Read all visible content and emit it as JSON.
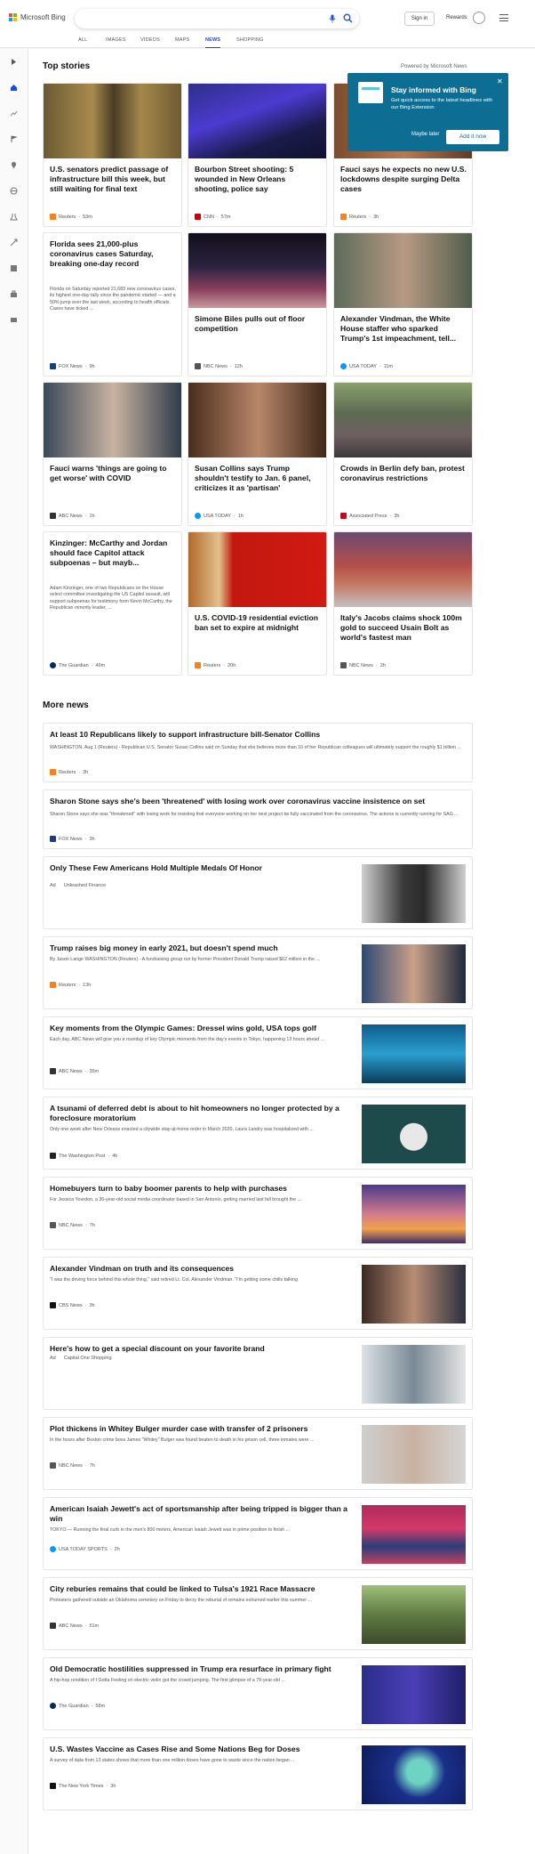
{
  "header": {
    "logo_text": "Microsoft Bing",
    "signin_label": "Sign in",
    "rewards_label": "Rewards",
    "brand_colors": [
      "#f25022",
      "#7fba00",
      "#00a4ef",
      "#ffb900"
    ]
  },
  "nav": {
    "items": [
      {
        "label": "ALL"
      },
      {
        "label": "IMAGES"
      },
      {
        "label": "VIDEOS"
      },
      {
        "label": "MAPS"
      },
      {
        "label": "NEWS",
        "active": true
      },
      {
        "label": "SHOPPING"
      }
    ]
  },
  "top_stories": {
    "title": "Top stories",
    "powered_by": "Powered by Microsoft News",
    "cards": [
      {
        "title": "U.S. senators predict passage of infrastructure bill this week, but still waiting for final text",
        "source": "Reuters",
        "time": "53m",
        "image": "senators-photo"
      },
      {
        "title": "Bourbon Street shooting: 5 wounded in New Orleans shooting, police say",
        "source": "CNN",
        "time": "57m",
        "image": "night-street-photo"
      },
      {
        "title": "Fauci says he expects no new U.S. lockdowns despite surging Delta cases",
        "source": "Reuters",
        "time": "3h",
        "image": "fauci-photo"
      },
      {
        "title": "Florida sees 21,000-plus coronavirus cases Saturday, breaking one-day record",
        "snippet": "Florida on Saturday reported 21,683 new coronavirus cases, its highest one-day tally since the pandemic started — and a 50% jump over the last week, according to health officials.  Cases have ticked ...",
        "source": "FOX News",
        "time": "9h"
      },
      {
        "title": "Simone Biles pulls out of floor competition",
        "source": "NBC News",
        "time": "12h",
        "image": "gymnast-photo"
      },
      {
        "title": "Alexander Vindman, the White House staffer who sparked Trump's 1st impeachment, tell...",
        "source": "USA TODAY",
        "time": "11m",
        "image": "vindman-photo"
      },
      {
        "title": "Fauci warns 'things are going to get worse' with COVID",
        "source": "ABC News",
        "time": "1h",
        "image": "fauci-photo-2"
      },
      {
        "title": "Susan Collins says Trump shouldn't testify to Jan. 6 panel, criticizes it as 'partisan'",
        "source": "USA TODAY",
        "time": "1h",
        "image": "collins-photo"
      },
      {
        "title": "Crowds in Berlin defy ban, protest coronavirus restrictions",
        "source": "Associated Press",
        "time": "3h",
        "image": "crowd-photo"
      },
      {
        "title": "Kinzinger: McCarthy and Jordan should face Capitol attack subpoenas – but mayb...",
        "snippet": "Adam Kinzinger, one of two Republicans on the House select committee investigating the US Capitol assault, will support subpoenas for testimony from Kevin McCarthy, the Republican minority leader, ...",
        "source": "The Guardian",
        "time": "49m"
      },
      {
        "title": "U.S. COVID-19 residential eviction ban set to expire at midnight",
        "source": "Reuters",
        "time": "20h",
        "image": "eviction-photo"
      },
      {
        "title": "Italy's Jacobs claims shock 100m gold to succeed Usain Bolt as world's fastest man",
        "source": "NBC News",
        "time": "2h",
        "image": "sprinter-photo"
      }
    ]
  },
  "popup": {
    "title": "Stay informed with Bing",
    "text": "Get quick access to the latest headlines with our Bing Extension",
    "later_label": "Maybe later",
    "add_label": "Add it now"
  },
  "more_news": {
    "title": "More news",
    "items": [
      {
        "title": "At least 10 Republicans likely to support infrastructure bill-Senator Collins",
        "snippet": "WASHINGTON, Aug 1 (Reuters) - Republican U.S. Senator Susan Collins said on Sunday that she believes more than 10 of her Republican colleagues will ultimately support the roughly $1 trillion ...",
        "source": "Reuters",
        "time": "3h"
      },
      {
        "title": "Sharon Stone says she's been 'threatened' with losing work over coronavirus vaccine insistence on set",
        "snippet": "Sharon Stone says she was \"threatened\" with losing work for insisting that everyone working on her next project be fully vaccinated from the coronavirus.  The actress is currently running for SAG ...",
        "source": "FOX News",
        "time": "3h"
      },
      {
        "title": "Only These Few Americans Hold Multiple Medals Of Honor",
        "ad": "Ad",
        "source": "Unleashed Finance",
        "image": "portrait-photo"
      },
      {
        "title": "Trump raises big money in early 2021, but doesn't spend much",
        "snippet": "By Jason Lange WASHINGTON (Reuters) - A fundraising group run by former President Donald Trump raised $62 million in the ...",
        "source": "Reuters",
        "time": "13h",
        "image": "trump-photo"
      },
      {
        "title": "Key moments from the Olympic Games: Dressel wins gold, USA tops golf",
        "snippet": "Each day, ABC News will give you a roundup of key Olympic moments from the day's events in Tokyo, happening 13 hours ahead ...",
        "source": "ABC News",
        "time": "35m",
        "image": "swimmer-photo"
      },
      {
        "title": "A tsunami of deferred debt is about to hit homeowners no longer protected by a foreclosure moratorium",
        "snippet": "Only one week after New Orleans enacted a citywide stay-at-home order in March 2020, Laura Landry was hospitalized with ...",
        "source": "The Washington Post",
        "time": "4h",
        "image": "house-illustration"
      },
      {
        "title": "Homebuyers turn to baby boomer parents to help with purchases",
        "snippet": "For Jessica Yourdon, a 36-year-old social media coordinator based in San Antonio, getting married last fall brought the ...",
        "source": "NBC News",
        "time": "7h",
        "image": "homebuyers-illustration"
      },
      {
        "title": "Alexander Vindman on truth and its consequences",
        "snippet": "\"I was the driving force behind this whole thing,\" said retired Lt. Col. Alexander Vindman. \"I'm getting some chills talking",
        "source": "CBS News",
        "time": "3h",
        "image": "vindman-photo-2"
      },
      {
        "title": "Here's how to get a special discount on your favorite brand",
        "ad": "Ad",
        "source": "Capital One Shopping",
        "image": "shopping-photo"
      },
      {
        "title": "Plot thickens in Whitey Bulger murder case with transfer of 2 prisoners",
        "snippet": "In the hours after Boston crime boss James \"Whitey\" Bulger was found beaten to death in his prison cell, three inmates were ...",
        "source": "NBC News",
        "time": "7h",
        "image": "bulger-photo"
      },
      {
        "title": "American Isaiah Jewett's act of sportsmanship after being tripped is bigger than a win",
        "snippet": "TOKYO — Running the final curb in the men's 800 meters, American Isaiah Jewett was in prime position to finish ...",
        "source": "USA TODAY SPORTS",
        "time": "2h",
        "image": "runners-photo"
      },
      {
        "title": "City reburies remains that could be linked to Tulsa's 1921 Race Massacre",
        "snippet": "Protesters gathered outside an Oklahoma cemetery on Friday to decry the reburial of remains exhumed earlier this summer ...",
        "source": "ABC News",
        "time": "51m",
        "image": "cemetery-photo"
      },
      {
        "title": "Old Democratic hostilities suppressed in Trump era resurface in primary fight",
        "snippet": "A hip-hop rendition of I Gotta Feeling on electric violin got the crowd jumping. The first glimpse of a 79-year-old ...",
        "source": "The Guardian",
        "time": "58m",
        "image": "rally-photo"
      },
      {
        "title": "U.S. Wastes Vaccine as Cases Rise and Some Nations Beg for Doses",
        "snippet": "A survey of data from 13 states shows that more than one million doses have gone to waste since the nation began ...",
        "source": "The New York Times",
        "time": "3h",
        "image": "vaccine-photo"
      }
    ]
  },
  "source_colors": {
    "Reuters": "#f58220",
    "CNN": "#cc0000",
    "FOX News": "#1b3d7a",
    "NBC News": "#555555",
    "USA TODAY": "#009bff",
    "ABC News": "#333333",
    "Associated Press": "#d0021b",
    "The Guardian": "#052962",
    "The Washington Post": "#222222",
    "CBS News": "#111111",
    "USA TODAY SPORTS": "#009bff",
    "The New York Times": "#111111"
  }
}
